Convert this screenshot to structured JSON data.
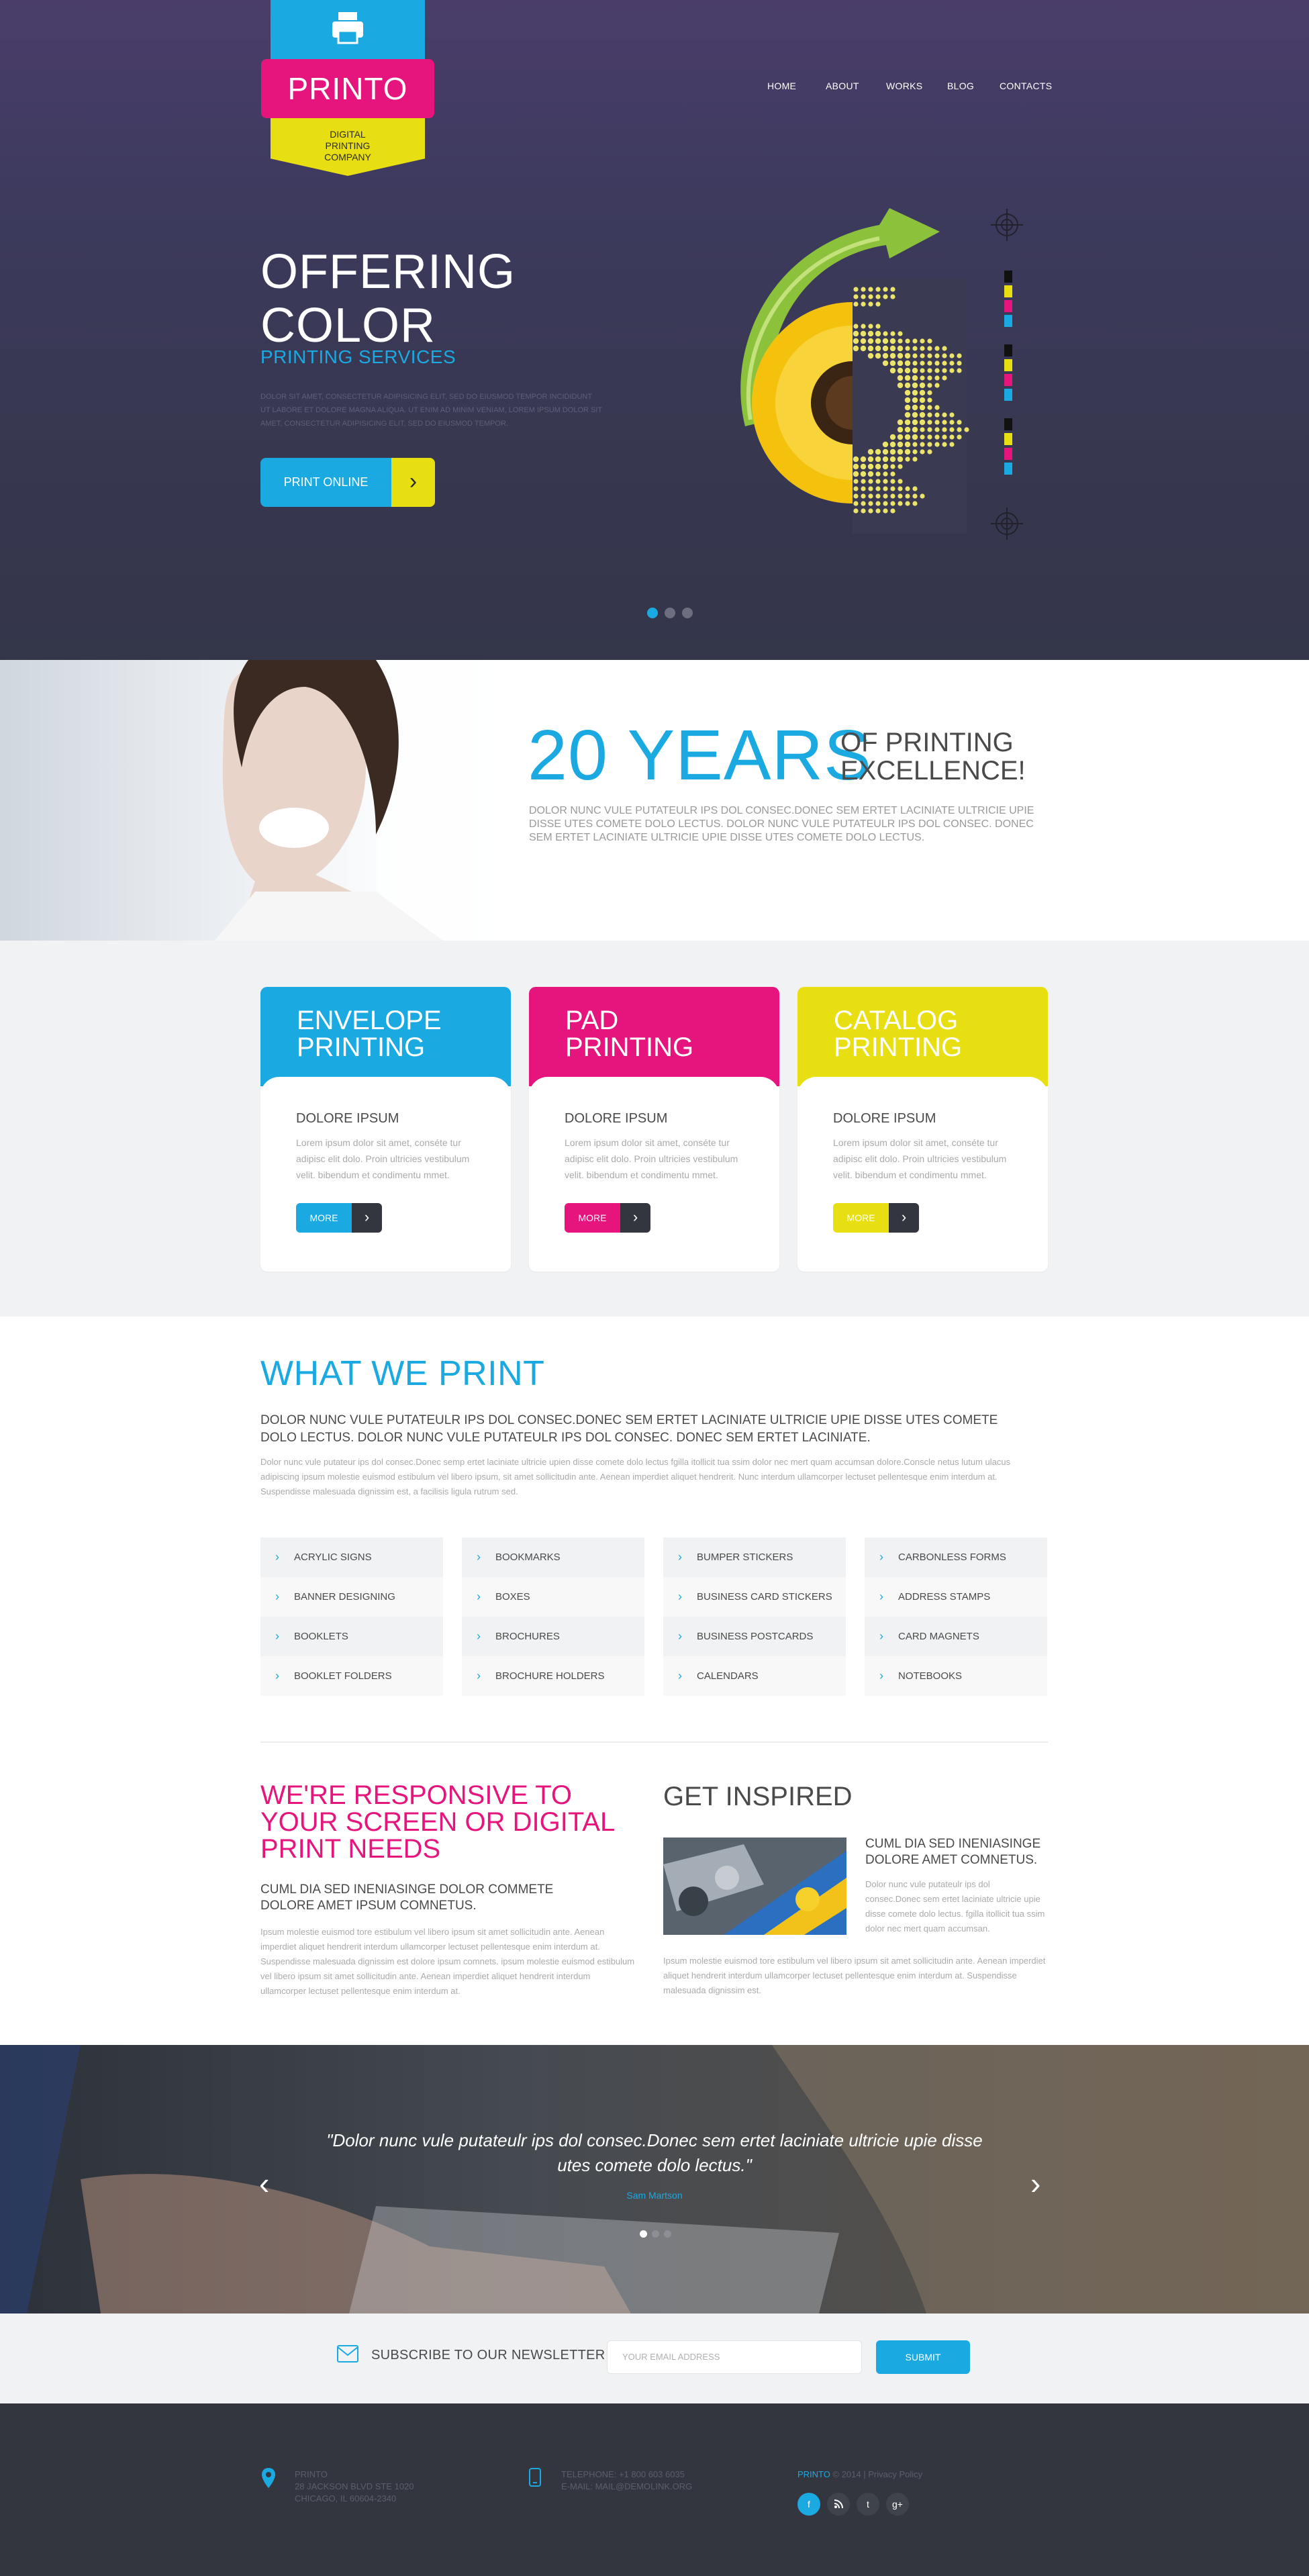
{
  "logo": {
    "name": "PRINTO",
    "tagline": "DIGITAL PRINTING COMPANY"
  },
  "nav": [
    "HOME",
    "ABOUT",
    "WORKS",
    "BLOG",
    "CONTACTS"
  ],
  "hero": {
    "title_line1": "OFFERING",
    "title_line2": "COLOR",
    "subtitle": "PRINTING SERVICES",
    "text": "DOLOR SIT AMET, CONSECTETUR ADIPISICING ELIT, SED DO EIUSMOD TEMPOR INCIDIDUNT UT LABORE ET DOLORE MAGNA ALIQUA. UT ENIM AD MINIM VENIAM, LOREM IPSUM DOLOR SIT AMET, CONSECTETUR ADIPISICING ELIT, SED DO EIUSMOD TEMPOR.",
    "button": "PRINT ONLINE",
    "slides_total": 3,
    "slide_active": 1
  },
  "years": {
    "big": "20 YEARS",
    "of_line1": "OF PRINTING",
    "of_line2": "EXCELLENCE!",
    "text": "DOLOR NUNC VULE PUTATEULR IPS DOL CONSEC.DONEC SEM ERTET LACINIATE ULTRICIE UPIE DISSE UTES COMETE DOLO LECTUS. DOLOR NUNC VULE PUTATEULR IPS DOL CONSEC. DONEC SEM ERTET LACINIATE ULTRICIE UPIE DISSE UTES COMETE DOLO LECTUS."
  },
  "cards": [
    {
      "title1": "ENVELOPE",
      "title2": "PRINTING",
      "subtitle": "DOLORE IPSUM",
      "text": "Lorem ipsum dolor sit amet, conséte tur adipisc elit dolo. Proin ultricies vestibulum velit. bibendum et condimentu mmet.",
      "more": "MORE",
      "color": "#1ba9e1"
    },
    {
      "title1": "PAD",
      "title2": "PRINTING",
      "subtitle": "DOLORE IPSUM",
      "text": "Lorem ipsum dolor sit amet, conséte tur adipisc elit dolo. Proin ultricies vestibulum velit. bibendum et condimentu mmet.",
      "more": "MORE",
      "color": "#e6157e"
    },
    {
      "title1": "CATALOG",
      "title2": "PRINTING",
      "subtitle": "DOLORE IPSUM",
      "text": "Lorem ipsum dolor sit amet, conséte tur adipisc elit dolo. Proin ultricies vestibulum velit. bibendum et condimentu mmet.",
      "more": "MORE",
      "color": "#e8df12"
    }
  ],
  "wwp": {
    "title": "WHAT WE PRINT",
    "lead": "DOLOR NUNC VULE PUTATEULR IPS DOL CONSEC.DONEC SEM ERTET LACINIATE ULTRICIE UPIE DISSE UTES COMETE DOLO LECTUS. DOLOR NUNC VULE PUTATEULR IPS DOL CONSEC. DONEC SEM ERTET LACINIATE.",
    "text": "Dolor nunc vule putateur ips dol consec.Donec semp ertet laciniate ultricie upien disse comete dolo lectus fgilla itollicit tua ssim dolor nec mert quam accumsan dolore.Conscle netus lutum ulacus adipiscing ipsum molestie euismod estibulum vel libero ipsum, sit amet sollicitudin ante. Aenean imperdiet aliquet hendrerit. Nunc interdum ullamcorper lectuset pellentesque enim interdum at. Suspendisse malesuada dignissim est, a facilisis ligula rutrum sed.",
    "columns": [
      [
        "ACRYLIC SIGNS",
        "BANNER DESIGNING",
        "BOOKLETS",
        "BOOKLET FOLDERS"
      ],
      [
        "BOOKMARKS",
        "BOXES",
        "BROCHURES",
        "BROCHURE HOLDERS"
      ],
      [
        "BUMPER STICKERS",
        "BUSINESS CARD STICKERS",
        "BUSINESS POSTCARDS",
        "CALENDARS"
      ],
      [
        "CARBONLESS FORMS",
        "ADDRESS STAMPS",
        "CARD MAGNETS",
        "NOTEBOOKS"
      ]
    ]
  },
  "responsive": {
    "title": "WE'RE RESPONSIVE TO YOUR SCREEN OR DIGITAL PRINT NEEDS",
    "lead": "CUML DIA SED INENIASINGE DOLOR COMMETE DOLORE AMET IPSUM COMNETUS.",
    "text": "Ipsum molestie euismod tore estibulum vel libero ipsum sit amet sollicitudin ante. Aenean imperdiet aliquet hendrerit interdum ullamcorper lectuset pellentesque enim interdum at. Suspendisse malesuada dignissim est dolore ipsum comnets. ipsum molestie euismod estibulum vel libero ipsum sit amet sollicitudin ante. Aenean imperdiet aliquet hendrerit interdum ullamcorper lectuset pellentesque enim interdum at."
  },
  "inspired": {
    "title": "GET INSPIRED",
    "lead": "CUML DIA SED INENIASINGE DOLORE AMET COMNETUS.",
    "text1": "Dolor nunc vule putateulr ips dol consec.Donec sem ertet laciniate ultricie upie disse comete dolo lectus. fgilla itollicit tua ssim dolor nec mert quam accumsan.",
    "text2": "Ipsum molestie euismod tore estibulum vel libero ipsum sit amet sollicitudin ante. Aenean imperdiet aliquet hendrerit interdum ullamcorper lectuset pellentesque enim interdum at. Suspendisse malesuada dignissim est."
  },
  "testimonial": {
    "quote_line1": "\"Dolor nunc vule putateulr ips dol consec.Donec sem ertet laciniate ultricie upie disse",
    "quote_line2": "utes comete dolo lectus.\"",
    "author": "Sam Martson",
    "slides_total": 3,
    "slide_active": 1
  },
  "newsletter": {
    "label": "SUBSCRIBE TO OUR NEWSLETTER",
    "placeholder": "YOUR EMAIL ADDRESS",
    "button": "SUBMIT"
  },
  "footer": {
    "address_line1": "PRINTO",
    "address_line2": "28 JACKSON BLVD STE 1020",
    "address_line3": "CHICAGO, IL 60604-2340",
    "phone": "TELEPHONE: +1 800 603 6035",
    "email": "E-MAIL: MAIL@DEMOLINK.ORG",
    "brand": "PRINTO",
    "copyright": " © 2014 | Privacy Policy",
    "social": [
      "f",
      "rss",
      "t",
      "g+"
    ]
  },
  "colors": {
    "cyan": "#1ba9e1",
    "magenta": "#e6157e",
    "yellow": "#e8df12",
    "dark": "#33363f"
  }
}
